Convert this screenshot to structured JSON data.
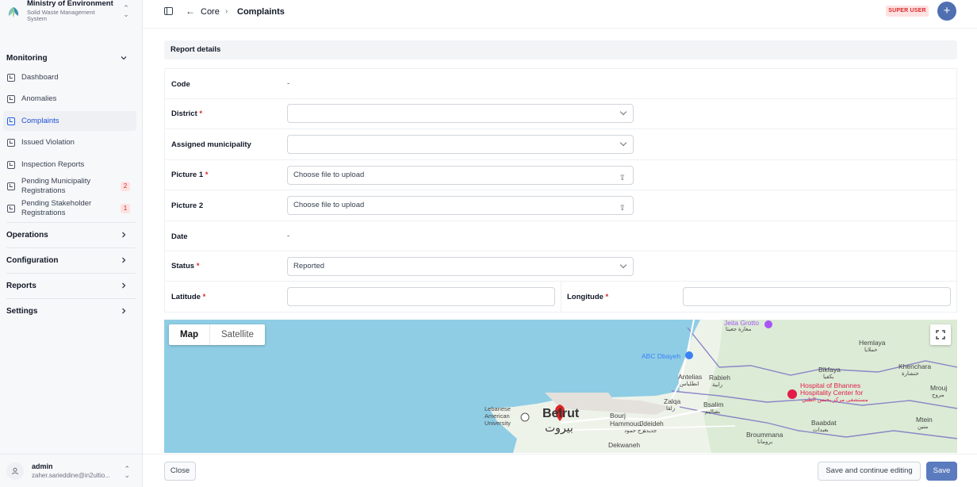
{
  "org": {
    "name": "Ministry of Environment",
    "subtitle": "Solid Waste Management System"
  },
  "sidebar": {
    "monitoring": {
      "title": "Monitoring",
      "items": [
        {
          "label": "Dashboard"
        },
        {
          "label": "Anomalies"
        },
        {
          "label": "Complaints"
        },
        {
          "label": "Issued Violation"
        },
        {
          "label": "Inspection Reports"
        },
        {
          "label": "Pending Municipality Registrations",
          "badge": "2"
        },
        {
          "label": "Pending Stakeholder Registrations",
          "badge": "1"
        }
      ]
    },
    "groups": [
      "Operations",
      "Configuration",
      "Reports",
      "Settings"
    ]
  },
  "user": {
    "name": "admin",
    "email": "zaher.sarieddine@in2ultio..."
  },
  "breadcrumb": {
    "parent": "Core",
    "current": "Complaints"
  },
  "role_badge": "SUPER USER",
  "section_title": "Report details",
  "form": {
    "code": {
      "label": "Code",
      "value": "-"
    },
    "district": {
      "label": "District",
      "value": ""
    },
    "municipality": {
      "label": "Assigned municipality",
      "value": ""
    },
    "picture1": {
      "label": "Picture 1",
      "placeholder": "Choose file to upload"
    },
    "picture2": {
      "label": "Picture 2",
      "placeholder": "Choose file to upload"
    },
    "date": {
      "label": "Date",
      "value": "-"
    },
    "status": {
      "label": "Status",
      "value": "Reported"
    },
    "latitude": {
      "label": "Latitude",
      "value": ""
    },
    "longitude": {
      "label": "Longitude",
      "value": ""
    },
    "required_mark": "*"
  },
  "map": {
    "tab_map": "Map",
    "tab_satellite": "Satellite",
    "labels": {
      "jeita": "Jeita Grotto",
      "jeita_ar": "مغارة جعيتا",
      "dbayeh": "ABC Dbayeh",
      "hemlaya": "Hemlaya",
      "hemlaya_ar": "حملايا",
      "antelias": "Antelias",
      "antelias_ar": "انطلياس",
      "rabieh": "Rabieh",
      "rabieh_ar": "رابية",
      "bikfaya": "Bikfaya",
      "bikfaya_ar": "بكفيا",
      "khenchara": "Khenchara",
      "khenchara_ar": "خنشارة",
      "hospital": "Hospital of Bhannes",
      "hospital2": "Hospitality Center for",
      "hospital_ar": "مستشفى مركز بحنس الطبي",
      "mrouj": "Mrouj",
      "mrouj_ar": "مروج",
      "zalqa": "Zalqa",
      "zalqa_ar": "زلقا",
      "bsalim": "Bsalim",
      "bsalim_ar": "بصاليم",
      "lau": "Lebanese American University",
      "beirut": "Beirut",
      "beirut_ar": "بيروت",
      "bourj": "Bourj Hammoud",
      "bourj_ar": "برج حمود",
      "jdeideh": "Jdeideh",
      "jdeideh_ar": "جديدة",
      "baabdat": "Baabdat",
      "baabdat_ar": "بعبدات",
      "broummana": "Broummana",
      "broummana_ar": "برومانا",
      "mtein": "Mtein",
      "mtein_ar": "متين",
      "dekwaneh": "Dekwaneh"
    }
  },
  "footer": {
    "close": "Close",
    "save_continue": "Save and continue editing",
    "save": "Save"
  },
  "colors": {
    "accent": "#5b7bbf",
    "required": "#dc2626",
    "water": "#8fcde5",
    "land": "#eef3ea"
  }
}
